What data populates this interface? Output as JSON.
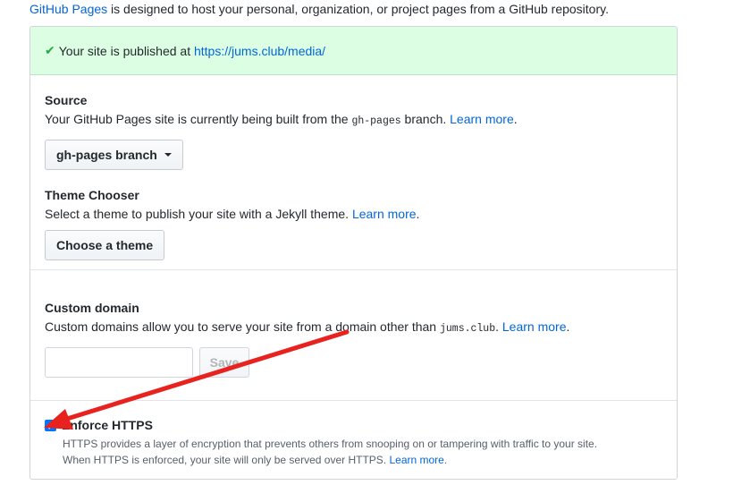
{
  "intro": {
    "link_text": "GitHub Pages",
    "text": " is designed to host your personal, organization, or project pages from a GitHub repository."
  },
  "flash": {
    "icon": "check-icon",
    "text": "Your site is published at ",
    "url": "https://jums.club/media/"
  },
  "source": {
    "title": "Source",
    "desc_before": "Your GitHub Pages site is currently being built from the ",
    "desc_code": "gh-pages",
    "desc_after": " branch. ",
    "learn_more": "Learn more",
    "period": ".",
    "branch_button": "gh-pages branch"
  },
  "theme": {
    "title": "Theme Chooser",
    "desc": "Select a theme to publish your site with a Jekyll theme. ",
    "learn_more": "Learn more",
    "period": ".",
    "button": "Choose a theme"
  },
  "custom_domain": {
    "title": "Custom domain",
    "desc_before": "Custom domains allow you to serve your site from a domain other than ",
    "desc_code": "jums.club",
    "desc_after": ". ",
    "learn_more": "Learn more",
    "period": ".",
    "input_value": "",
    "save_button": "Save"
  },
  "https": {
    "label": "Enforce HTTPS",
    "checked": true,
    "line1": "HTTPS provides a layer of encryption that prevents others from snooping on or tampering with traffic to your site.",
    "line2": "When HTTPS is enforced, your site will only be served over HTTPS. ",
    "learn_more": "Learn more",
    "period": "."
  },
  "colors": {
    "link": "#0366d6",
    "success_bg": "#dcffe4",
    "check": "#28a745",
    "annotation_arrow": "#e8231f"
  }
}
